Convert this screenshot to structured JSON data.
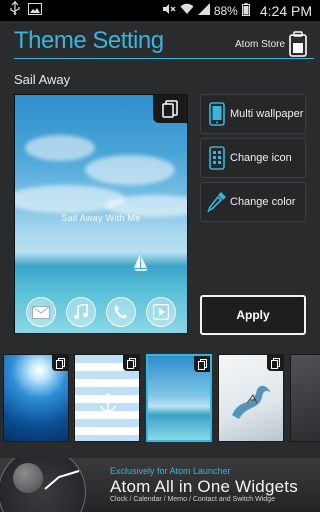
{
  "status_bar": {
    "battery": "88%",
    "time": "4:24 PM",
    "icons": [
      "usb-icon",
      "image-icon",
      "mute-icon",
      "wifi-icon",
      "signal-icon",
      "battery-icon"
    ]
  },
  "header": {
    "title": "Theme Setting",
    "store_label": "Atom Store",
    "accent_color": "#39b4dc"
  },
  "theme": {
    "name": "Sail Away",
    "preview_caption": "Sail Away With Me",
    "dock_icons": [
      "mail-icon",
      "music-icon",
      "phone-icon",
      "play-icon"
    ]
  },
  "options": {
    "multi_wallpaper": "Multi wallpaper",
    "change_icon": "Change icon",
    "change_color": "Change color",
    "apply": "Apply"
  },
  "thumbnails": [
    {
      "name": "blue-sunburst",
      "selected": false
    },
    {
      "name": "striped-anchor",
      "selected": false
    },
    {
      "name": "sail-away",
      "selected": true
    },
    {
      "name": "ink-splash",
      "selected": false
    },
    {
      "name": "dark-partial",
      "selected": false
    }
  ],
  "banner": {
    "subtitle": "Exclusively for Atom Launcher",
    "title": "Atom All in One Widgets",
    "description": "Clock / Calendar / Memo / Contact and Switch Widge"
  }
}
